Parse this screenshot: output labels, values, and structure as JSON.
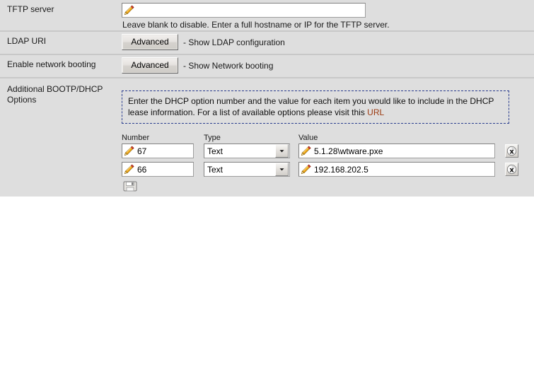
{
  "panel": {
    "background_color": "#dedede",
    "rows": [
      {
        "label": "TFTP server",
        "field_value": "",
        "hint": "Leave blank to disable. Enter a full hostname or IP for the TFTP server."
      },
      {
        "label": "LDAP URI",
        "button_label": "Advanced",
        "button_caption": "- Show LDAP configuration"
      },
      {
        "label": "Enable network booting",
        "button_label": "Advanced",
        "button_caption": "- Show Network booting"
      },
      {
        "label": "Additional BOOTP/DHCP Options"
      }
    ]
  },
  "info_box": {
    "text_before_link": "Enter the DHCP option number and the value for each item you would like to include in the DHCP lease information. For a list of available options please visit this ",
    "link_label": "URL",
    "link_color": "#9c3b12",
    "border_color": "#2a3d8f"
  },
  "dhcp_options": {
    "headers": {
      "number": "Number",
      "type": "Type",
      "value": "Value"
    },
    "rows": [
      {
        "number": "67",
        "type": "Text",
        "value": "5.1.28\\wtware.pxe",
        "delete_icon": "delete-x-icon"
      },
      {
        "number": "66",
        "type": "Text",
        "value": "192.168.202.5",
        "delete_icon": "delete-x-icon"
      }
    ],
    "add_row_icon": "add-row-icon"
  },
  "icons": {
    "pencil": "pencil-icon",
    "dropdown_arrow": "chevron-down-icon",
    "delete": "delete-x-icon"
  }
}
